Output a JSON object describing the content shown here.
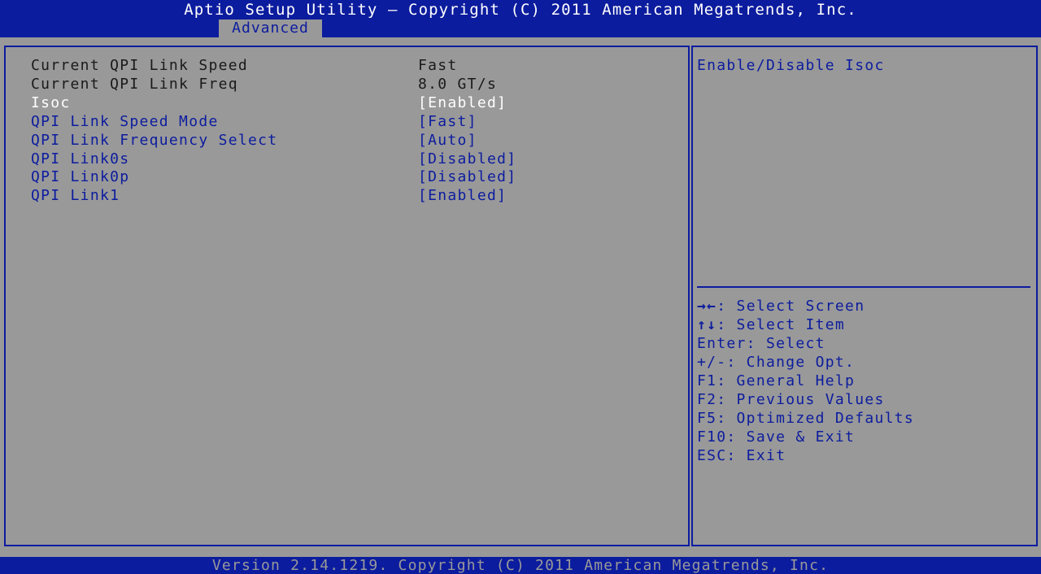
{
  "header": {
    "title": "Aptio Setup Utility – Copyright (C) 2011 American Megatrends, Inc.",
    "active_tab": "Advanced"
  },
  "settings": [
    {
      "label": "Current QPI Link Speed",
      "value": "Fast",
      "kind": "info"
    },
    {
      "label": "Current QPI Link Freq",
      "value": "8.0 GT/s",
      "kind": "info"
    },
    {
      "label": "Isoc",
      "value": "[Enabled]",
      "kind": "option",
      "selected": true
    },
    {
      "label": "QPI Link Speed Mode",
      "value": "[Fast]",
      "kind": "option"
    },
    {
      "label": "QPI Link Frequency Select",
      "value": "[Auto]",
      "kind": "option"
    },
    {
      "label": "QPI Link0s",
      "value": "[Disabled]",
      "kind": "option"
    },
    {
      "label": "QPI Link0p",
      "value": "[Disabled]",
      "kind": "option"
    },
    {
      "label": "QPI Link1",
      "value": "[Enabled]",
      "kind": "option"
    }
  ],
  "help": {
    "text": "Enable/Disable Isoc"
  },
  "keys": [
    {
      "glyph": "→←",
      "text": ": Select Screen"
    },
    {
      "glyph": "↑↓",
      "text": ": Select Item"
    },
    {
      "glyph": "",
      "text": "Enter: Select"
    },
    {
      "glyph": "",
      "text": "+/-: Change Opt."
    },
    {
      "glyph": "",
      "text": "F1: General Help"
    },
    {
      "glyph": "",
      "text": "F2: Previous Values"
    },
    {
      "glyph": "",
      "text": "F5: Optimized Defaults"
    },
    {
      "glyph": "",
      "text": "F10: Save & Exit"
    },
    {
      "glyph": "",
      "text": "ESC: Exit"
    }
  ],
  "footer": {
    "text": "Version 2.14.1219. Copyright (C) 2011 American Megatrends, Inc."
  },
  "colors": {
    "blue": "#0c1c9e",
    "background": "#999999",
    "selected_text": "#ffffff",
    "info_text": "#1a1a1a"
  }
}
